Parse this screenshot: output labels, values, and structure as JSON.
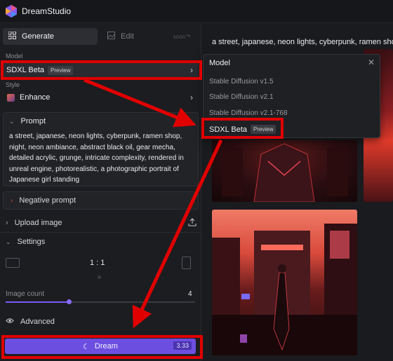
{
  "app": {
    "name": "DreamStudio"
  },
  "tabs": {
    "generate": "Generate",
    "edit": "Edit",
    "edit_badge": "soon™"
  },
  "model": {
    "label": "Model",
    "selected": "SDXL Beta",
    "badge": "Preview"
  },
  "style": {
    "label": "Style",
    "selected": "Enhance"
  },
  "prompt": {
    "label": "Prompt",
    "text": "a street, japanese, neon lights, cyberpunk, ramen shop, night, neon ambiance, abstract black oil, gear mecha, detailed acrylic, grunge, intricate complexity, rendered in unreal engine, photorealistic, a photographic portrait of Japanese girl standing"
  },
  "negative_prompt": {
    "label": "Negative prompt"
  },
  "upload": {
    "label": "Upload image"
  },
  "settings": {
    "label": "Settings",
    "aspect_ratio": "1 : 1",
    "image_count_label": "Image count",
    "image_count": "4",
    "image_count_fraction": 0.33
  },
  "advanced": {
    "label": "Advanced"
  },
  "dream": {
    "label": "Dream",
    "cost": "3.33"
  },
  "results": {
    "prompt_title": "a street, japanese, neon lights, cyberpunk, ramen shop"
  },
  "dropdown": {
    "title": "Model",
    "options": [
      "Stable Diffusion v1.5",
      "Stable Diffusion v2.1",
      "Stable Diffusion v2.1-768",
      "SDXL Beta"
    ],
    "selected_badge": "Preview"
  },
  "colors": {
    "accent": "#6c4fe0",
    "highlight": "#e00000"
  },
  "icons": {
    "logo": "dreamstudio-logo-icon",
    "generate": "grid-icon",
    "edit": "edit-image-icon",
    "upload": "upload-icon",
    "settings": "chevron-down-icon",
    "advanced": "eye-icon",
    "dream": "moon-icon",
    "close": "close-icon"
  }
}
